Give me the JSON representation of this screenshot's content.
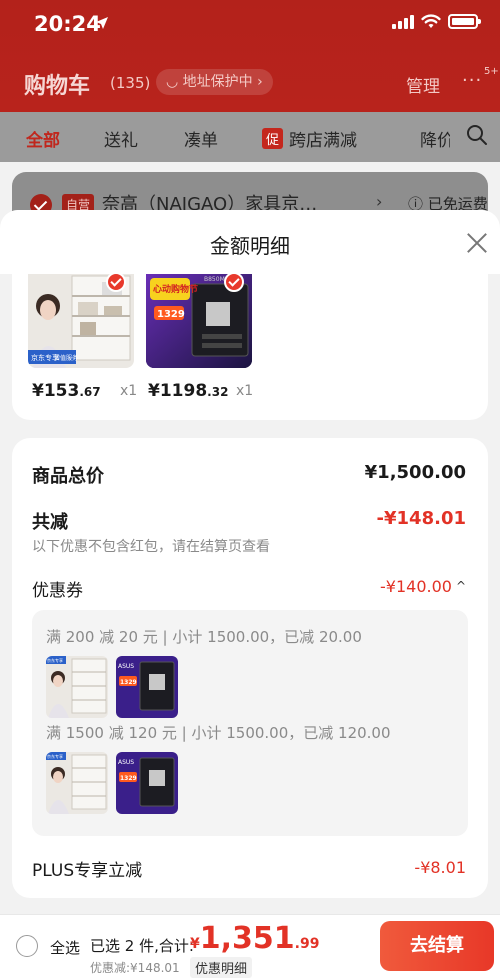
{
  "status_bar": {
    "time": "20:24"
  },
  "cart_header": {
    "title": "购物车",
    "count": "(135)",
    "address_pill": "◡ 地址保护中 ›",
    "manage_label": "管理",
    "more_badge": "5+"
  },
  "filter_tabs": [
    {
      "label": "全部"
    },
    {
      "label": "送礼"
    },
    {
      "label": "凑单"
    },
    {
      "tag": "促",
      "label": "跨店满减"
    },
    {
      "label": "降价"
    }
  ],
  "store": {
    "self_tag": "自营",
    "name": "奈高（NAIGAO）家具京…",
    "shipping": "ⓘ 已免运费"
  },
  "sheet": {
    "title": "金额明细",
    "products": [
      {
        "price_int": "¥153",
        "price_dec": ".67",
        "qty": "x1",
        "image": "storage-shelf-photo",
        "image_text": [
          "京东专享",
          "增值服务"
        ]
      },
      {
        "price_int": "¥1198",
        "price_dec": ".32",
        "qty": "x1",
        "image": "motherboard-photo",
        "image_text": [
          "心动购物节",
          "1329",
          "B850M-PL"
        ]
      }
    ],
    "total_label": "商品总价",
    "total_value": "¥1,500.00",
    "reduction_label": "共减",
    "reduction_value": "-¥148.01",
    "reduction_note": "以下优惠不包含红包，请在结算页查看",
    "coupon_label": "优惠券",
    "coupon_value": "-¥140.00",
    "coupon_lines": [
      "满 200 减 20 元 | 小计 1500.00，已减 20.00",
      "满 1500 减 120 元 | 小计 1500.00，已减 120.00"
    ],
    "thumb_text": {
      "shelf_tag": "京东专享",
      "board_brand": "ASUS",
      "board_price": "1329"
    },
    "plus_label": "PLUS专享立减",
    "plus_value": "-¥8.01"
  },
  "bottom_bar": {
    "select_all": "全选",
    "selected": "已选 2 件,合计:",
    "currency": "¥",
    "total_int": "1,351",
    "total_dec": ".99",
    "discount": "优惠减:¥148.01",
    "detail_link": "优惠明细",
    "checkout": "去结算"
  },
  "colors": {
    "brand_red": "#e23226",
    "header_red": "#b3221b"
  }
}
